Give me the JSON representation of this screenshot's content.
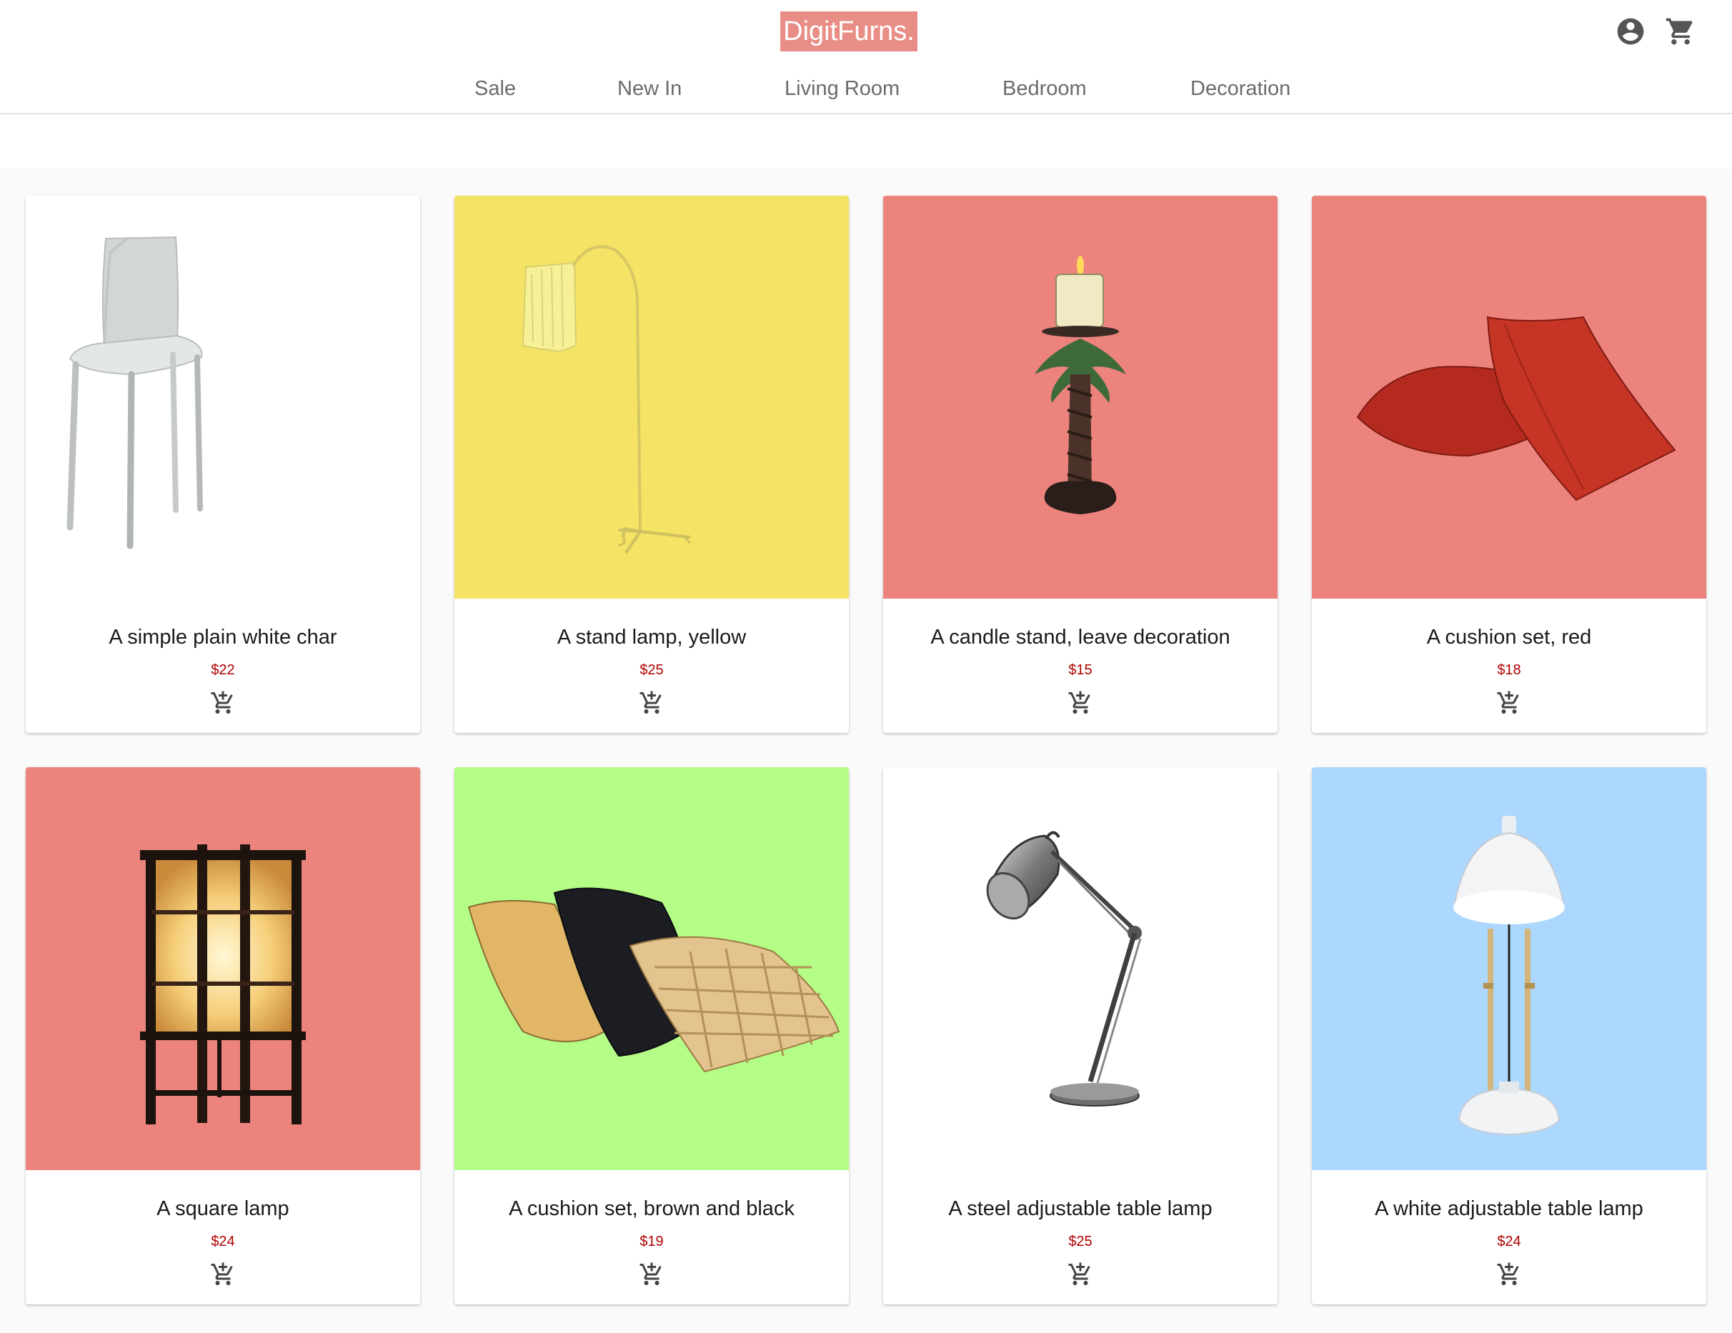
{
  "brand": {
    "logo_text": "DigitFurns.",
    "accent_color": "#e88e86"
  },
  "header": {
    "account_icon": "account-circle-icon",
    "cart_icon": "shopping-cart-icon"
  },
  "nav": {
    "items": [
      "Sale",
      "New In",
      "Living Room",
      "Bedroom",
      "Decoration"
    ]
  },
  "products": [
    {
      "title": "A simple plain white char",
      "price": "$22",
      "bg": "#ffffff",
      "image": "white-chair"
    },
    {
      "title": "A stand lamp, yellow",
      "price": "$25",
      "bg": "#f4e364",
      "image": "yellow-floor-lamp"
    },
    {
      "title": "A candle stand, leave decoration",
      "price": "$15",
      "bg": "#ec837d",
      "image": "candle-stand"
    },
    {
      "title": "A cushion set, red",
      "price": "$18",
      "bg": "#ec837d",
      "image": "red-cushions"
    },
    {
      "title": "A square lamp",
      "price": "$24",
      "bg": "#ec837d",
      "image": "square-lamp"
    },
    {
      "title": "A cushion set, brown and black",
      "price": "$19",
      "bg": "#b4fd86",
      "image": "brown-black-cushions"
    },
    {
      "title": "A steel adjustable table lamp",
      "price": "$25",
      "bg": "#ffffff",
      "image": "steel-desk-lamp"
    },
    {
      "title": "A white adjustable table lamp",
      "price": "$24",
      "bg": "#acd7fe",
      "image": "white-desk-lamp"
    }
  ],
  "product_action_icon": "add-shopping-cart-icon",
  "price_color": "#b00000"
}
